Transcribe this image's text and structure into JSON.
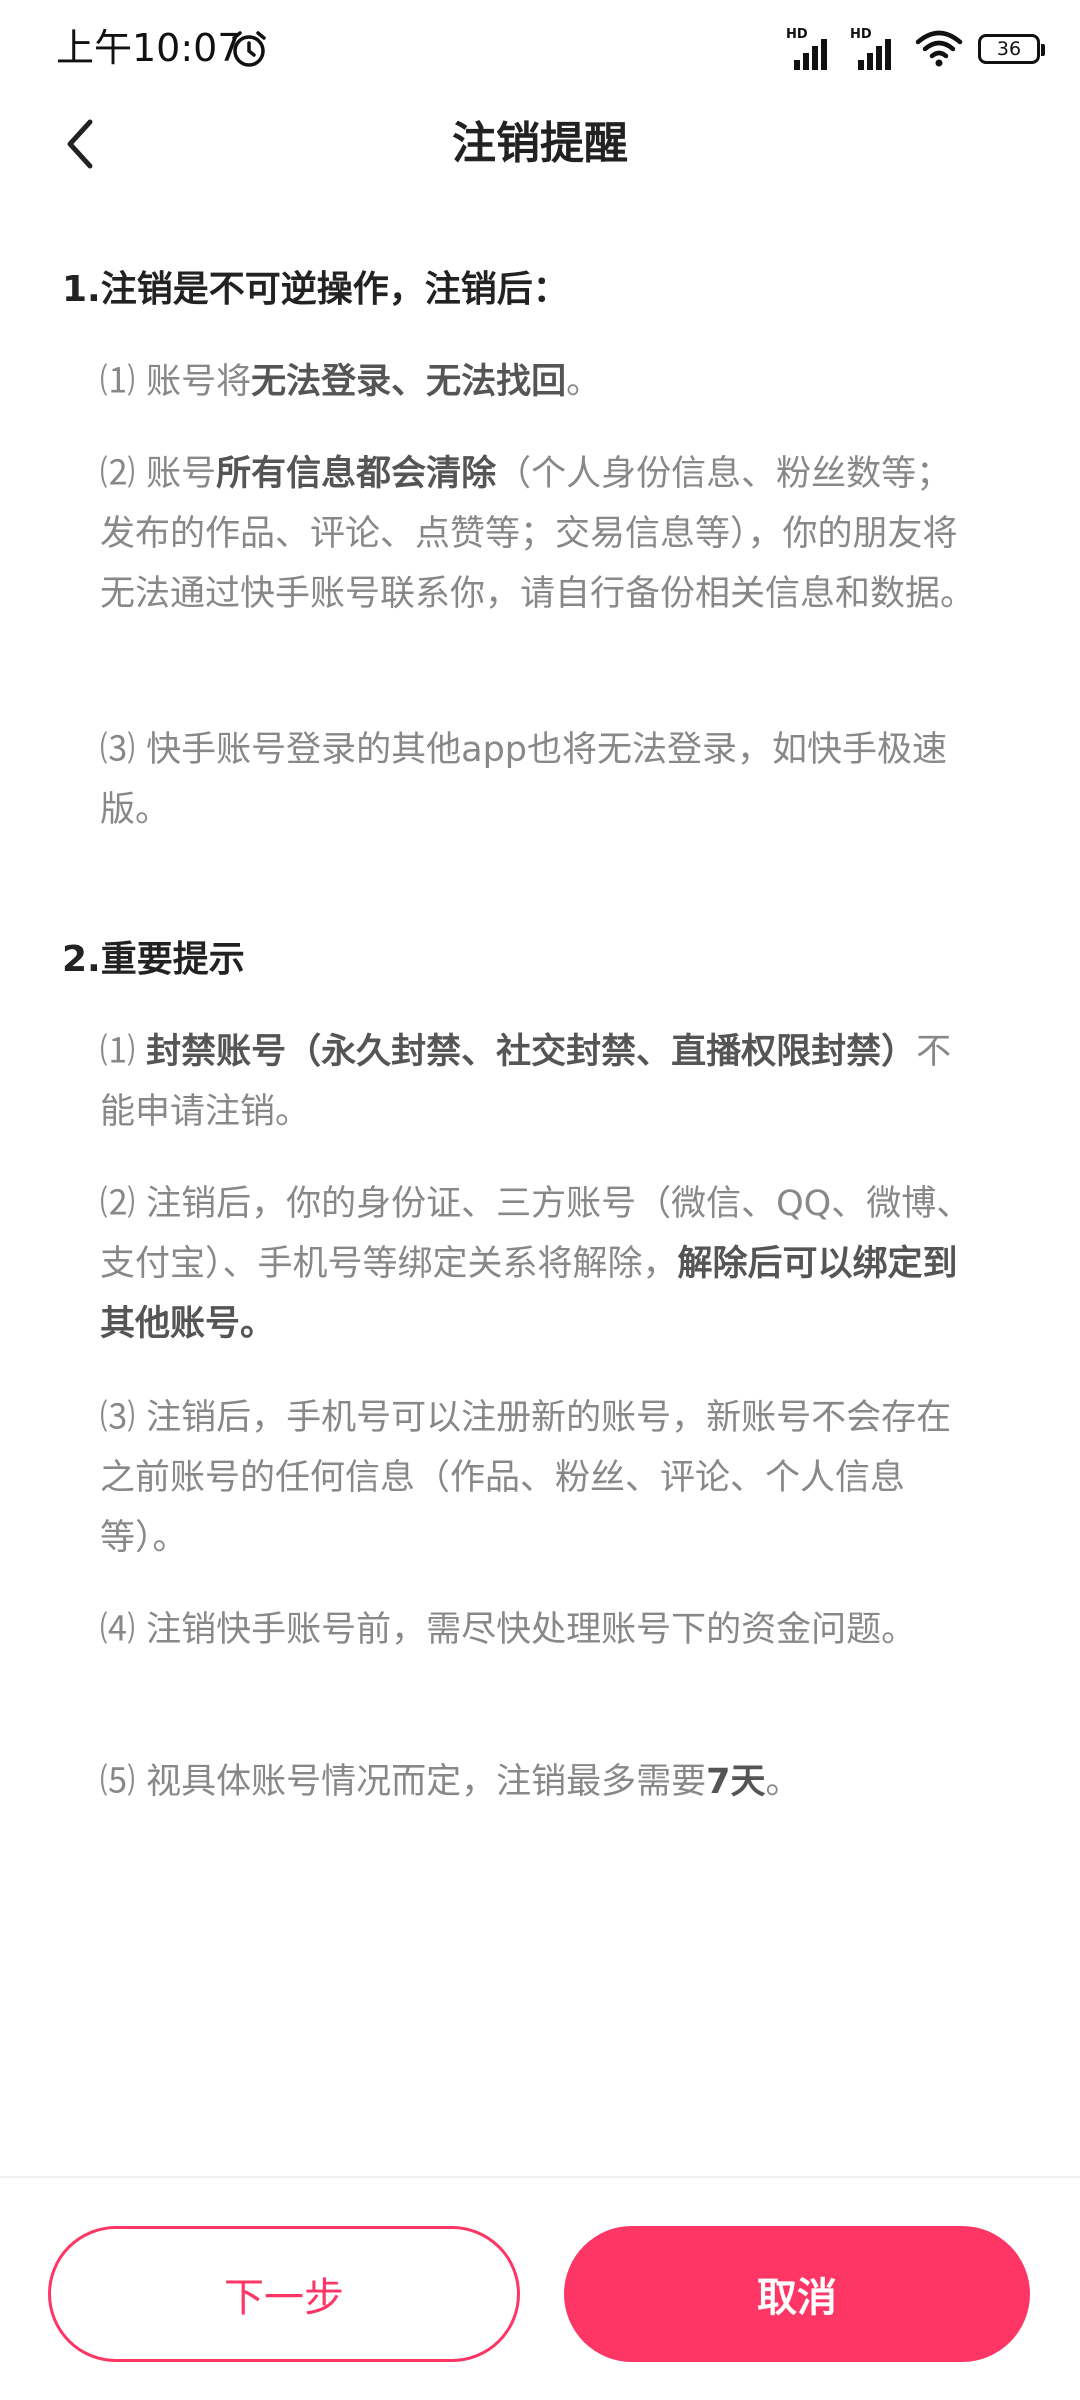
{
  "status_bar": {
    "time": "上午10:07",
    "signal1_label": "HD",
    "signal2_label": "HD",
    "battery": "36",
    "icons": [
      "alarm-icon",
      "signal-icon",
      "signal-icon",
      "wifi-icon",
      "battery-icon"
    ]
  },
  "nav": {
    "title": "注销提醒",
    "back_icon": "chevron-left-icon"
  },
  "section1": {
    "title": "1.注销是不可逆操作，注销后：",
    "item1": {
      "prefix": "⑴ 账号将",
      "bold": "无法登录、无法找回",
      "suffix": "。"
    },
    "item2": {
      "prefix": "⑵ 账号",
      "bold": "所有信息都会清除",
      "suffix": "（个人身份信息、粉丝数等；发布的作品、评论、点赞等；交易信息等），你的朋友将无法通过快手账号联系你，请自行备份相关信息和数据。"
    },
    "item3": {
      "text": "⑶ 快手账号登录的其他app也将无法登录，如快手极速版。"
    }
  },
  "section2": {
    "title": "2.重要提示",
    "item1": {
      "prefix": "⑴ ",
      "bold": "封禁账号（永久封禁、社交封禁、直播权限封禁）",
      "suffix": "不能申请注销。"
    },
    "item2": {
      "prefix": "⑵ 注销后，你的身份证、三方账号（微信、QQ、微博、支付宝）、手机号等绑定关系将解除，",
      "bold": "解除后可以绑定到其他账号。"
    },
    "item3": {
      "text": "⑶ 注销后，手机号可以注册新的账号，新账号不会存在之前账号的任何信息（作品、粉丝、评论、个人信息等）。"
    },
    "item4": {
      "text": "⑷ 注销快手账号前，需尽快处理账号下的资金问题。"
    },
    "item5": {
      "prefix": "⑸ 视具体账号情况而定，注销最多需要",
      "bold": "7天",
      "suffix": "。"
    }
  },
  "buttons": {
    "next_label": "下一步",
    "cancel_label": "取消"
  },
  "colors": {
    "accent": "#fe3666",
    "title_text": "#222222",
    "body_text": "#888888",
    "emphasis_text": "#555555"
  }
}
